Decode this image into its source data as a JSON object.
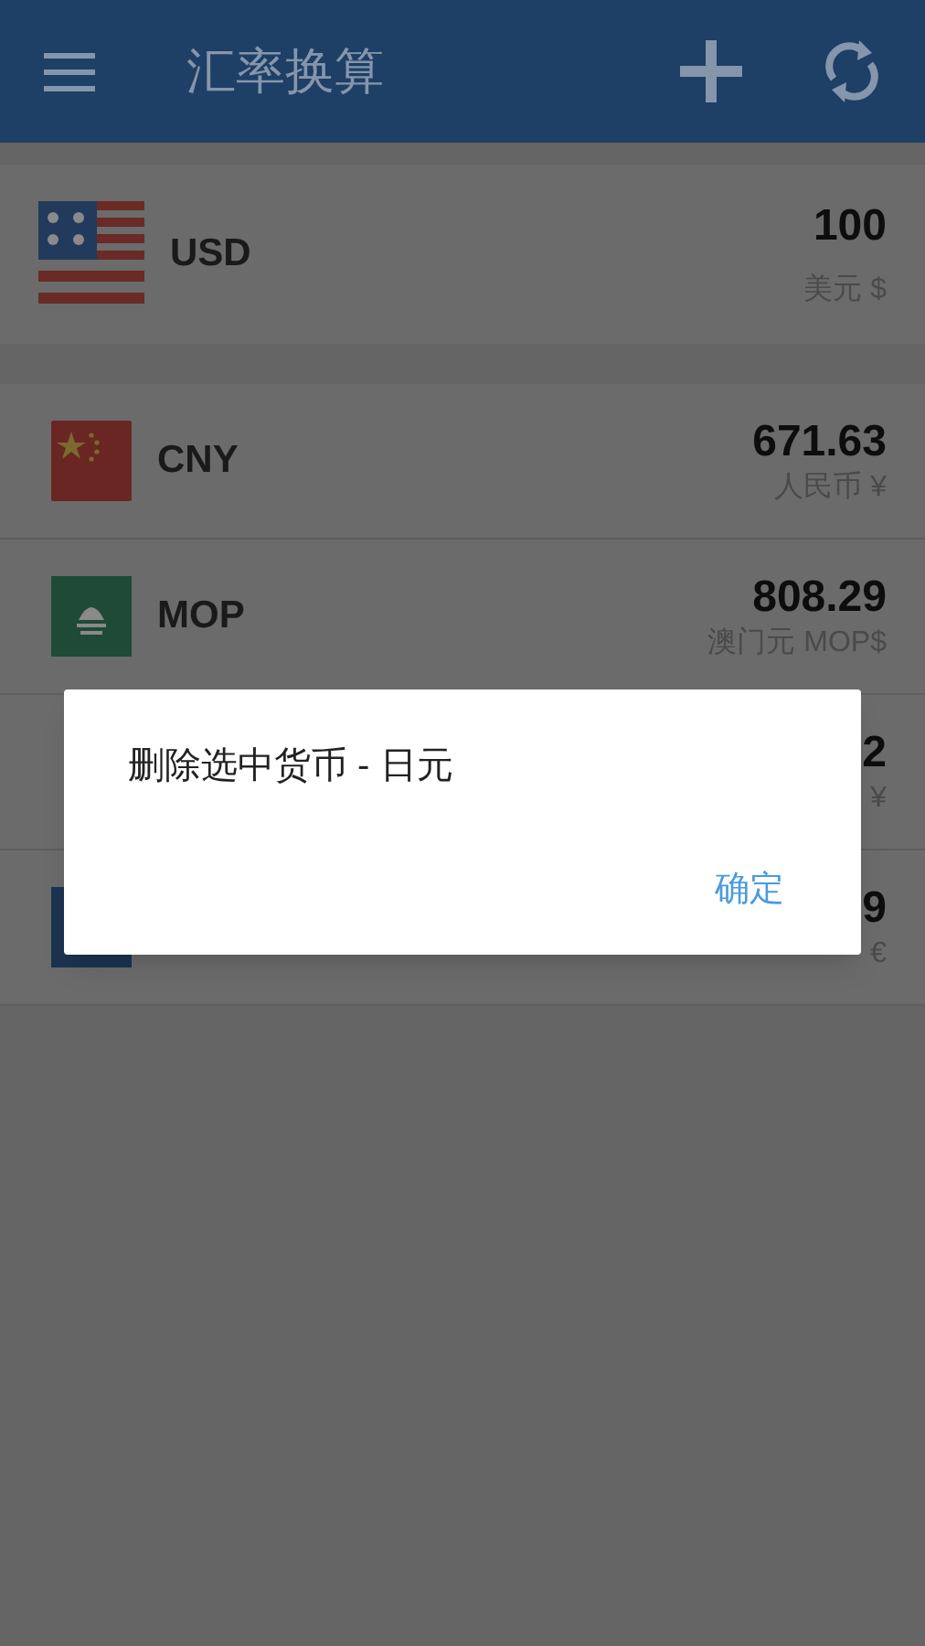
{
  "app_bar": {
    "title": "汇率换算"
  },
  "base": {
    "code": "USD",
    "amount": "100",
    "name": "美元 $",
    "kind": "us"
  },
  "rows": [
    {
      "code": "CNY",
      "amount": "671.63",
      "name": "人民币 ¥",
      "kind": "cn"
    },
    {
      "code": "MOP",
      "amount": "808.29",
      "name": "澳门元 MOP$",
      "kind": "mo"
    },
    {
      "amount": "2",
      "name": "¥",
      "kind": "none"
    },
    {
      "amount": "9",
      "name": "€",
      "kind": "eu"
    }
  ],
  "dialog": {
    "message": "删除选中货币 - 日元",
    "button": "确定"
  }
}
